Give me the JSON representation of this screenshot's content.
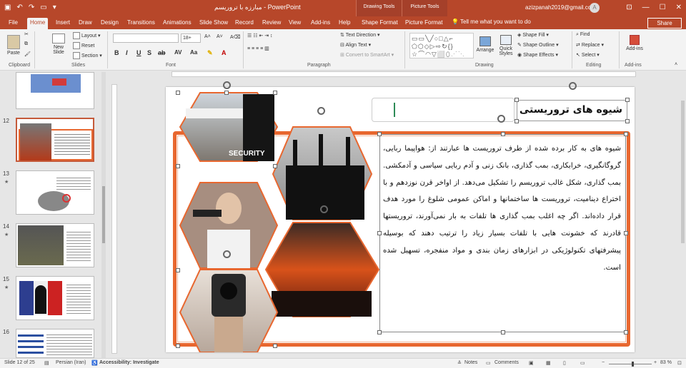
{
  "window": {
    "doc_title": "مبارزه با تروریسم - PowerPoint",
    "user_email": "azizpanah2019@gmail.com",
    "avatar_letter": "A",
    "context_tabs": [
      "Drawing Tools",
      "Picture Tools"
    ]
  },
  "tabs": [
    "File",
    "Home",
    "Insert",
    "Draw",
    "Design",
    "Transitions",
    "Animations",
    "Slide Show",
    "Record",
    "Review",
    "View",
    "Add-ins",
    "Help",
    "Shape Format",
    "Picture Format"
  ],
  "tell_me": "Tell me what you want to do",
  "share_label": "Share",
  "ribbon": {
    "clipboard": {
      "paste": "Paste",
      "label": "Clipboard"
    },
    "slides": {
      "new_slide": "New Slide",
      "layout": "Layout",
      "reset": "Reset",
      "section": "Section",
      "label": "Slides"
    },
    "font": {
      "size": "18+",
      "label": "Font"
    },
    "paragraph": {
      "text_direction": "Text Direction",
      "align_text": "Align Text",
      "smartart": "Convert to SmartArt",
      "label": "Paragraph"
    },
    "drawing": {
      "arrange": "Arrange",
      "quick_styles": "Quick Styles",
      "shape_fill": "Shape Fill",
      "shape_outline": "Shape Outline",
      "shape_effects": "Shape Effects",
      "label": "Drawing"
    },
    "editing": {
      "find": "Find",
      "replace": "Replace",
      "select": "Select",
      "label": "Editing"
    },
    "addins": {
      "addins": "Add-ins",
      "label": "Add-ins"
    }
  },
  "thumbnails": [
    {
      "num": "",
      "selected": false
    },
    {
      "num": "12",
      "selected": true
    },
    {
      "num": "13",
      "selected": false
    },
    {
      "num": "14",
      "selected": false
    },
    {
      "num": "15",
      "selected": false
    },
    {
      "num": "16",
      "selected": false
    }
  ],
  "slide": {
    "title": "شیوه های تروریستی",
    "body": "شیوه های به کار برده شده از طرف تروریست ها عبارتند از: هواپیما ربایی، گروگانگیری، خرابکاری، بمب گذاری، بانک زنی و آدم ربایی سیاسی و آدمکشی. بمب گذاری، شکل غالب تروریسم را تشکیل می‌دهد. از اواخر قرن نوزدهم و با اختراع دینامیت، تروریست ها ساختمانها و اماکن عمومی شلوغ را مورد هدف قرار داده‌اند. اگر چه اغلب بمب گذاری ها تلفات به بار نمی‌آورند، تروریستها قادرند که خشونت هایی با تلفات بسیار زیاد را ترتیب دهند که بوسیله پیشرفتهای تکنولوژیکی در ابزارهای زمان بندی و مواد منفجره، تسهیل شده است.",
    "security_text": "SECURITY"
  },
  "status": {
    "slide_of": "Slide 12 of 25",
    "language": "Persian (Iran)",
    "accessibility": "Accessibility: Investigate",
    "notes": "Notes",
    "comments": "Comments",
    "zoom": "83 %"
  },
  "colors": {
    "accent": "#b7472a",
    "frame": "#e8672f"
  }
}
